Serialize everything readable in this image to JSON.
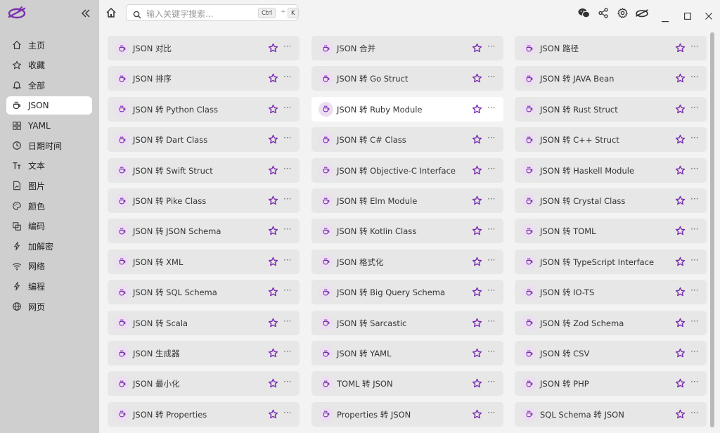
{
  "colors": {
    "accent": "#7a2fb0",
    "sidebar_bg": "#cfcfcf",
    "card_bg": "#e7e7e7"
  },
  "sidebar": {
    "items": [
      {
        "label": "主页",
        "icon": "home-icon"
      },
      {
        "label": "收藏",
        "icon": "star-icon"
      },
      {
        "label": "全部",
        "icon": "bell-icon"
      },
      {
        "label": "JSON",
        "icon": "cup-icon",
        "active": true
      },
      {
        "label": "YAML",
        "icon": "grid-icon"
      },
      {
        "label": "日期时间",
        "icon": "clock-icon"
      },
      {
        "label": "文本",
        "icon": "text-icon"
      },
      {
        "label": "图片",
        "icon": "image-icon"
      },
      {
        "label": "颜色",
        "icon": "palette-icon"
      },
      {
        "label": "编码",
        "icon": "copy-icon"
      },
      {
        "label": "加解密",
        "icon": "bolt-icon"
      },
      {
        "label": "网络",
        "icon": "wifi-icon"
      },
      {
        "label": "编程",
        "icon": "bolt-icon"
      },
      {
        "label": "网页",
        "icon": "globe-icon"
      }
    ]
  },
  "search": {
    "placeholder": "输入关键字搜索...",
    "kbd1": "Ctrl",
    "plus": "+",
    "kbd2": "K"
  },
  "tools": [
    "JSON 对比",
    "JSON 合并",
    "JSON 路径",
    "JSON 排序",
    "JSON 转 Go Struct",
    "JSON 转 JAVA Bean",
    "JSON 转 Python Class",
    "JSON 转 Ruby Module",
    "JSON 转 Rust Struct",
    "JSON 转 Dart Class",
    "JSON 转 C# Class",
    "JSON 转 C++ Struct",
    "JSON 转 Swift Struct",
    "JSON 转 Objective-C Interface",
    "JSON 转 Haskell Module",
    "JSON 转 Pike Class",
    "JSON 转 Elm Module",
    "JSON 转 Crystal Class",
    "JSON 转 JSON Schema",
    "JSON 转 Kotlin Class",
    "JSON 转 TOML",
    "JSON 转 XML",
    "JSON 格式化",
    "JSON 转 TypeScript Interface",
    "JSON 转 SQL Schema",
    "JSON 转 Big Query Schema",
    "JSON 转 IO-TS",
    "JSON 转 Scala",
    "JSON 转 Sarcastic",
    "JSON 转 Zod Schema",
    "JSON 生成器",
    "JSON 转 YAML",
    "JSON 转 CSV",
    "JSON 最小化",
    "TOML 转 JSON",
    "JSON 转 PHP",
    "JSON 转 Properties",
    "Properties 转 JSON",
    "SQL Schema 转 JSON"
  ],
  "active_tool": "JSON 转 Ruby Module",
  "more_glyph": "···"
}
